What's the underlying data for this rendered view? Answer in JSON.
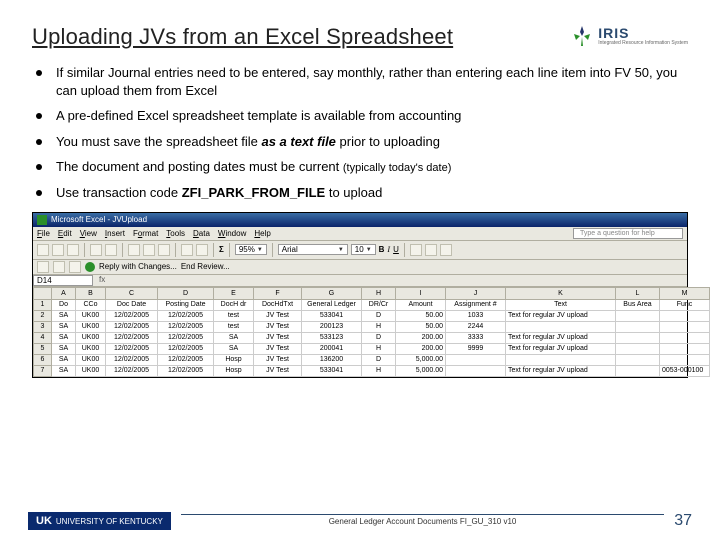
{
  "title": "Uploading JVs from an Excel Spreadsheet",
  "logo": {
    "text": "IRIS",
    "sub": "Integrated Resource\nInformation System"
  },
  "bullets": [
    {
      "pre": "If similar Journal entries need to be entered, say monthly, rather than entering each line item into FV 50, you can upload them from Excel"
    },
    {
      "pre": "A pre-defined Excel spreadsheet template is available from accounting"
    },
    {
      "pre": "You must save the spreadsheet file ",
      "ital": "as a text file",
      "post": " prior to uploading"
    },
    {
      "pre": "The document and posting dates must be current ",
      "small": "(typically today's date)"
    },
    {
      "pre": "Use transaction code ",
      "bold": "ZFI_PARK_FROM_FILE",
      "post": " to upload"
    }
  ],
  "excel": {
    "titlebar": "Microsoft Excel - JVUpload",
    "menus": [
      "File",
      "Edit",
      "View",
      "Insert",
      "Format",
      "Tools",
      "Data",
      "Window",
      "Help"
    ],
    "help_placeholder": "Type a question for help",
    "zoom": "95%",
    "font_name": "Arial",
    "font_size": "10",
    "reply": "Reply with Changes...",
    "end_review": "End Review...",
    "name_box": "D14",
    "col_letters": [
      "",
      "A",
      "B",
      "C",
      "D",
      "E",
      "F",
      "G",
      "H",
      "I",
      "J",
      "K",
      "L",
      "M"
    ],
    "header_row": [
      "1",
      "Do",
      "CCo",
      "Doc Date",
      "Posting Date",
      "DocH dr",
      "DocHdTxt",
      "General Ledger",
      "DR/Cr",
      "Amount",
      "Assignment #",
      "Text",
      "Bus Area",
      "Func"
    ],
    "rows": [
      [
        "2",
        "SA",
        "UK00",
        "12/02/2005",
        "12/02/2005",
        "test",
        "JV Test",
        "533041",
        "D",
        "50.00",
        "1033",
        "Text for regular JV upload",
        "",
        ""
      ],
      [
        "3",
        "SA",
        "UK00",
        "12/02/2005",
        "12/02/2005",
        "test",
        "JV Test",
        "200123",
        "H",
        "50.00",
        "2244",
        "",
        "",
        ""
      ],
      [
        "4",
        "SA",
        "UK00",
        "12/02/2005",
        "12/02/2005",
        "SA",
        "JV Test",
        "533123",
        "D",
        "200.00",
        "3333",
        "Text for regular JV upload",
        "",
        ""
      ],
      [
        "5",
        "SA",
        "UK00",
        "12/02/2005",
        "12/02/2005",
        "SA",
        "JV Test",
        "200041",
        "H",
        "200.00",
        "9999",
        "Text for regular JV upload",
        "",
        ""
      ],
      [
        "6",
        "SA",
        "UK00",
        "12/02/2005",
        "12/02/2005",
        "Hosp",
        "JV Test",
        "136200",
        "D",
        "5,000.00",
        "",
        "",
        "",
        ""
      ],
      [
        "7",
        "SA",
        "UK00",
        "12/02/2005",
        "12/02/2005",
        "Hosp",
        "JV Test",
        "533041",
        "H",
        "5,000.00",
        "",
        "Text for regular JV upload",
        "",
        "0053-000100"
      ]
    ]
  },
  "footer": {
    "uk": "UNIVERSITY OF KENTUCKY",
    "text": "General Ledger Account Documents FI_GU_310 v10",
    "page": "37"
  }
}
